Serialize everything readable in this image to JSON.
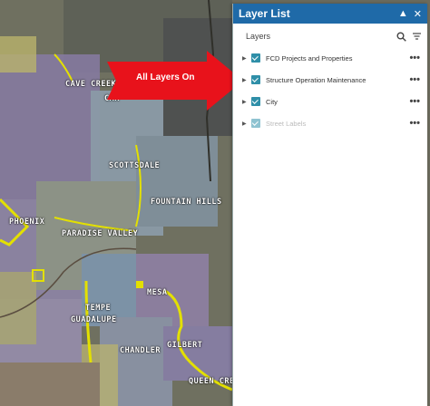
{
  "map": {
    "labels": {
      "cave_creek": "CAVE CREEK",
      "carefree": "CAR",
      "scottsdale": "SCOTTSDALE",
      "fountain_hills": "FOUNTAIN HILLS",
      "phoenix": "PHOENIX",
      "paradise_valley": "PARADISE VALLEY",
      "tempe": "TEMPE",
      "mesa": "MESA",
      "guadalupe": "GUADALUPE",
      "chandler": "CHANDLER",
      "gilbert": "GILBERT",
      "queen_creek": "QUEEN CREE"
    }
  },
  "annotation": {
    "text": "All Layers On",
    "color": "#e8121b"
  },
  "panel": {
    "title": "Layer List",
    "header_color": "#1f6aa8",
    "section_label": "Layers",
    "layers": [
      {
        "name": "FCD Projects and Properties",
        "checked": true
      },
      {
        "name": "Structure Operation Maintenance",
        "checked": true
      },
      {
        "name": "City",
        "checked": true
      },
      {
        "name": "Street Labels",
        "checked": true,
        "dimmed": true
      }
    ],
    "more_label": "•••"
  }
}
